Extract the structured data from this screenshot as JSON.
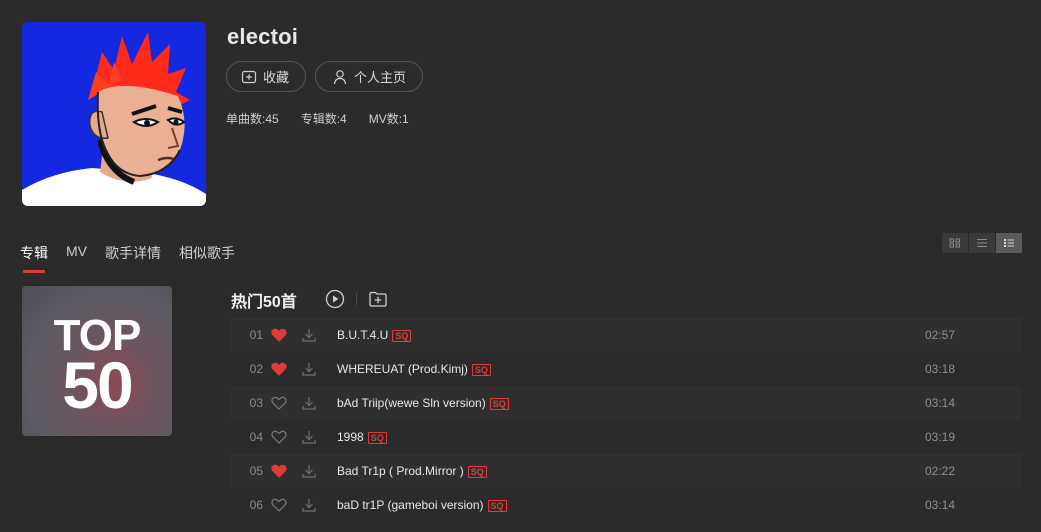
{
  "artist": {
    "name": "electoi",
    "collect_label": "收藏",
    "homepage_label": "个人主页",
    "stats": {
      "singles": "单曲数:45",
      "albums": "专辑数:4",
      "mvs": "MV数:1"
    }
  },
  "tabs": [
    {
      "label": "专辑",
      "active": true
    },
    {
      "label": "MV",
      "active": false
    },
    {
      "label": "歌手详情",
      "active": false
    },
    {
      "label": "相似歌手",
      "active": false
    }
  ],
  "view_modes": [
    "grid-icon",
    "list-icon",
    "detail-list-icon"
  ],
  "album": {
    "cover_line1": "TOP",
    "cover_line2": "50",
    "title": "热门50首"
  },
  "songs": [
    {
      "no": "01",
      "liked": true,
      "name": "B.U.T.4.U",
      "badge": "SQ",
      "duration": "02:57"
    },
    {
      "no": "02",
      "liked": true,
      "name": "WHEREUAT (Prod.Kimj)",
      "badge": "SQ",
      "duration": "03:18"
    },
    {
      "no": "03",
      "liked": false,
      "name": "bAd Triip(wewe Sln version)",
      "badge": "SQ",
      "duration": "03:14"
    },
    {
      "no": "04",
      "liked": false,
      "name": "1998",
      "badge": "SQ",
      "duration": "03:19"
    },
    {
      "no": "05",
      "liked": true,
      "name": "Bad Tr1p ( Prod.Mirror )",
      "badge": "SQ",
      "duration": "02:22"
    },
    {
      "no": "06",
      "liked": false,
      "name": "baD tr1P (gameboi version)",
      "badge": "SQ",
      "duration": "03:14"
    }
  ],
  "colors": {
    "accent": "#e03a3a",
    "background": "#2b2b2b",
    "heart_liked": "#e03a3a",
    "heart_unliked": "#7a7a7a"
  }
}
